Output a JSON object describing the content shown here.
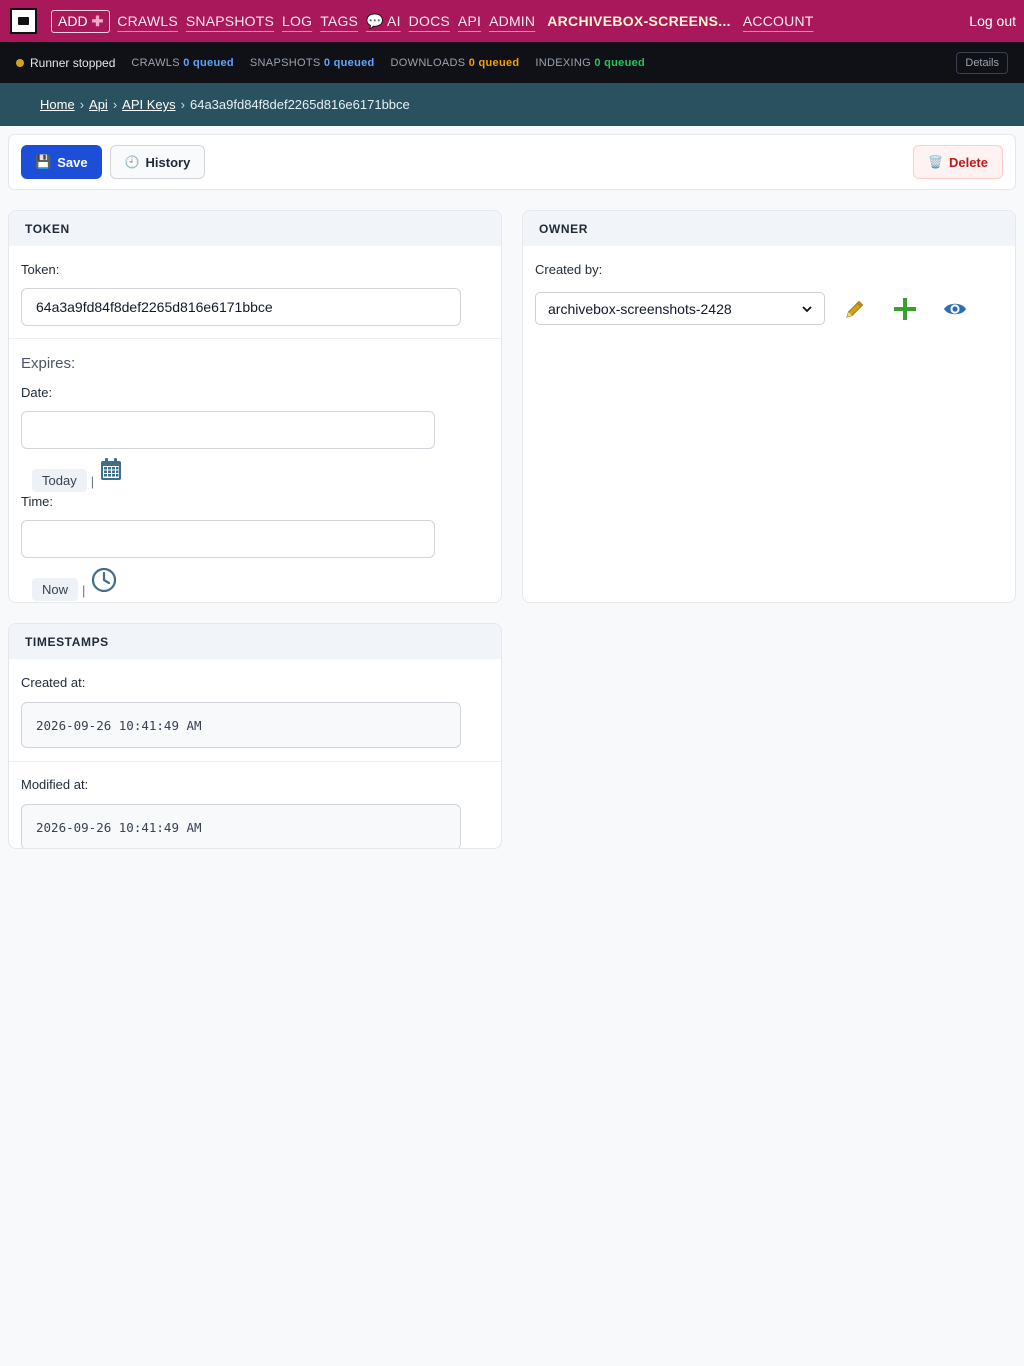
{
  "nav": {
    "add_label": "ADD",
    "links": [
      "CRAWLS",
      "SNAPSHOTS",
      "LOG",
      "TAGS",
      "💬 AI",
      "DOCS",
      "API",
      "ADMIN"
    ],
    "user": "ARCHIVEBOX-SCREENS...",
    "account": "ACCOUNT",
    "logout": "Log out"
  },
  "status": {
    "runner": "Runner stopped",
    "crawls_label": "CRAWLS",
    "crawls_value": "0 queued",
    "snapshots_label": "SNAPSHOTS",
    "snapshots_value": "0 queued",
    "downloads_label": "DOWNLOADS",
    "downloads_value": "0 queued",
    "indexing_label": "INDEXING",
    "indexing_value": "0 queued",
    "details": "Details",
    "colors": {
      "runner_dot": "#d4a21a",
      "crawls": "#60a5fa",
      "downloads": "#f59e0b",
      "indexing": "#22c55e"
    }
  },
  "breadcrumb": {
    "items": [
      "Home",
      "Api",
      "API Keys"
    ],
    "current": "64a3a9fd84f8def2265d816e6171bbce"
  },
  "toolbar": {
    "save": "Save",
    "history": "History",
    "delete": "Delete",
    "save_icon": "floppy-disk-icon",
    "history_icon": "clock-icon",
    "delete_icon": "trash-icon"
  },
  "token_panel": {
    "title": "TOKEN",
    "token_label": "Token:",
    "token_value": "64a3a9fd84f8def2265d816e6171bbce",
    "expires_label": "Expires:",
    "date_label": "Date:",
    "date_value": "",
    "today": "Today",
    "time_label": "Time:",
    "time_value": "",
    "now": "Now",
    "sep": "|"
  },
  "owner_panel": {
    "title": "OWNER",
    "created_by_label": "Created by:",
    "created_by_value": "archivebox-screenshots-2428",
    "icons": [
      "pencil-icon",
      "plus-icon",
      "eye-icon"
    ]
  },
  "timestamps_panel": {
    "title": "TIMESTAMPS",
    "created_label": "Created at:",
    "created_value": "2026-09-26 10:41:49 AM",
    "modified_label": "Modified at:",
    "modified_value": "2026-09-26 10:41:49 AM"
  }
}
